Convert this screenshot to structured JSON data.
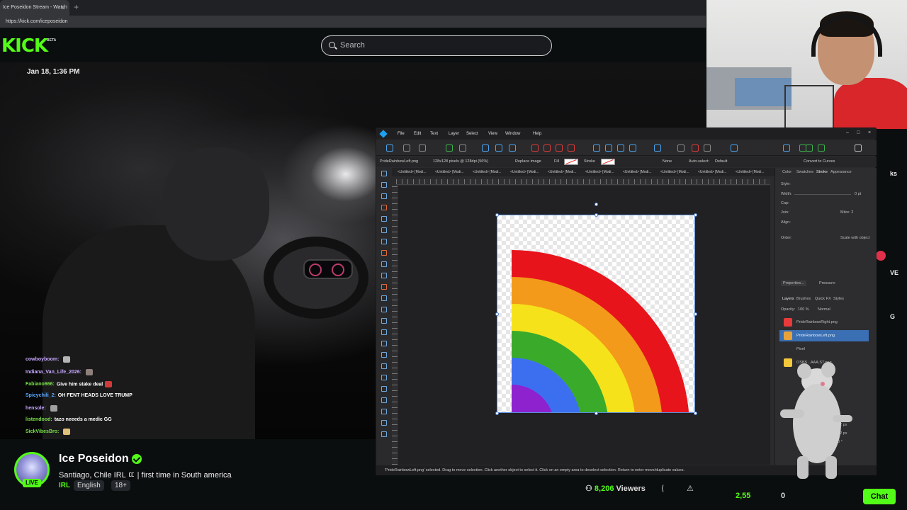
{
  "browser": {
    "tab_title": "Ice Poseidon Stream - Watch",
    "tab_close": "×",
    "new_tab": "+",
    "url": "https://kick.com/iceposeidon"
  },
  "kick": {
    "logo": "KICK",
    "beta": "BETA",
    "search_placeholder": "Search"
  },
  "video": {
    "timestamp": "Jan 18, 1:36 PM"
  },
  "chat": [
    {
      "user": "cowboyboom:",
      "msg": "",
      "color": "#c7a8ff",
      "emote": "#b5b5b5"
    },
    {
      "user": "Indiana_Van_Life_2026:",
      "msg": "",
      "color": "#c7a8ff",
      "emote": "#8f7f7a"
    },
    {
      "user": "Fabiano666:",
      "msg": "Give him stake deal",
      "color": "#7ae04a",
      "emote": "#d03a3a"
    },
    {
      "user": "Spicychili_2:",
      "msg": "OH FENT HEADS LOVE TRUMP",
      "color": "#5aa9ff",
      "emote": ""
    },
    {
      "user": "hensole:",
      "msg": "",
      "color": "#c7a8ff",
      "emote": "#a0a0a0"
    },
    {
      "user": "listendood:",
      "msg": "tazo neeeds a medic GG",
      "color": "#7ae04a",
      "emote": ""
    },
    {
      "user": "SickVibesBro:",
      "msg": "",
      "color": "#7ae04a",
      "emote": "#e0c07a"
    }
  ],
  "stream": {
    "name": "Ice Poseidon",
    "live": "LIVE",
    "title": "Santiago, Chile IRL ㄸ | first time in South america",
    "category": "IRL",
    "tags": [
      "English",
      "18+"
    ],
    "viewers_count": "8,206",
    "viewers_label": "Viewers",
    "share_icon": "⟨",
    "report_icon": "⚠",
    "kicks": "2,55",
    "chest": "0",
    "chat_button": "Chat"
  },
  "right_column_text": [
    "ks",
    "VE",
    "G"
  ],
  "designer": {
    "menus": [
      "File",
      "Edit",
      "Text",
      "Layer",
      "Select",
      "View",
      "Window",
      "Help"
    ],
    "window_buttons": [
      "–",
      "□",
      "×"
    ],
    "context": {
      "file": "PrideRainbowLeft.png",
      "size": "128x128 pixels @ 128dpi (56%)",
      "replace": "Replace image",
      "fill": "Fill",
      "stroke": "Stroke",
      "none": "None",
      "auto_select": "Auto-select:",
      "default": "Default",
      "convert": "Convert to Curves"
    },
    "doc_tabs": [
      "<Untitled> [Modi...",
      "<Untitled> [Modi...",
      "<Untitled> [Modi...",
      "<Untitled> [Modi...",
      "<Untitled> [Modi...",
      "<Untitled> [Modi...",
      "<Untitled> [Modi...",
      "<Untitled> [Modi...",
      "<Untitled> [Modi...",
      "<Untitled> [Modi..."
    ],
    "panel_tabs": [
      "Color",
      "Swatches",
      "Stroke",
      "Appearance"
    ],
    "stroke_rows": [
      "Style:",
      "Width:",
      "Cap:",
      "Join:",
      "Align:",
      "Order:"
    ],
    "width_value": "0 pt",
    "mitre": "Mitre: 2",
    "scale": "Scale with object",
    "properties": "Properties...",
    "pressure": "Pressure:",
    "layer_tabs": [
      "Layers",
      "Brushes",
      "Quick FX",
      "Styles"
    ],
    "opacity": "Opacity:",
    "opacity_value": "100 %",
    "blend": "Normal",
    "layers": [
      {
        "name": "PrideRainbowRight.png",
        "selected": false,
        "thumb": "#e83a3a"
      },
      {
        "name": "PrideRainbowLeft.png",
        "selected": true,
        "thumb": "#e8a23a"
      },
      {
        "name": "Pixel",
        "selected": false,
        "thumb": "#2d2d2f"
      },
      {
        "name": "OSBS...AAA.ST.png",
        "selected": false,
        "thumb": "#f3c83a"
      }
    ],
    "transform": [
      "72 px",
      "72 px",
      "0 °"
    ],
    "status": "'PrideRainbowLeft.png' selected. Drag to move selection. Click another object to select it. Click on an empty area to deselect selection. Return to enter move/duplicate values."
  },
  "colors": {
    "kick_green": "#53fc18",
    "rainbow": [
      "#e8141c",
      "#f39a1a",
      "#f6e21a",
      "#3aaa2a",
      "#3c6ff0",
      "#8e22cf"
    ]
  }
}
